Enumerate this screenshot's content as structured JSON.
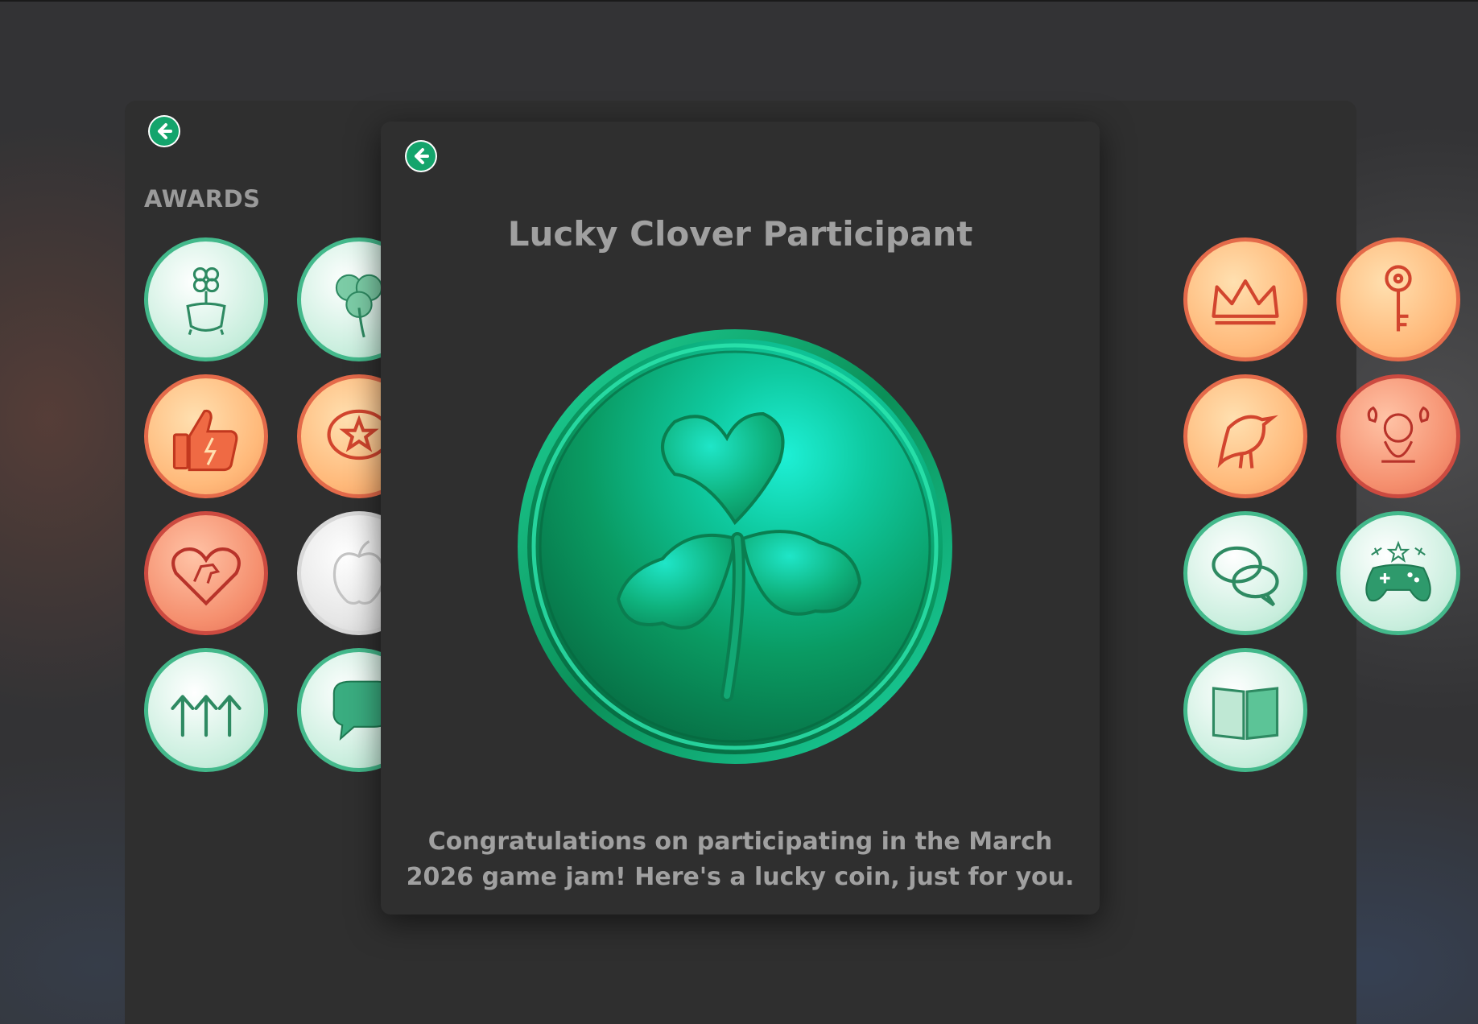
{
  "awards_panel": {
    "title": "AWARDS",
    "badges": [
      {
        "name": "pot-of-gold-clover-badge",
        "style": "green"
      },
      {
        "name": "shamrock-badge",
        "style": "green"
      },
      {
        "name": "crown-badge",
        "style": "orange"
      },
      {
        "name": "key-badge",
        "style": "orange"
      },
      {
        "name": "thumbs-up-lightning-badge",
        "style": "orange"
      },
      {
        "name": "star-speech-bubble-badge",
        "style": "orange"
      },
      {
        "name": "bird-badge",
        "style": "orange"
      },
      {
        "name": "dragon-creature-badge",
        "style": "red"
      },
      {
        "name": "horse-heart-badge",
        "style": "red"
      },
      {
        "name": "apple-badge",
        "style": "silver"
      },
      {
        "name": "chat-bubbles-badge",
        "style": "green"
      },
      {
        "name": "gamepad-badge",
        "style": "green"
      },
      {
        "name": "three-arrows-up-badge",
        "style": "green"
      },
      {
        "name": "speech-bubble-badge",
        "style": "green"
      },
      {
        "name": "open-book-badge",
        "style": "green"
      }
    ]
  },
  "modal": {
    "title": "Lucky Clover Participant",
    "description": "Congratulations on participating in the March 2026 game jam! Here's a lucky coin, just for you.",
    "coin_icon": "shamrock-coin"
  },
  "colors": {
    "accent_green": "#14a46c",
    "panel_bg": "#2f2f2f",
    "text_gray": "#a0a0a0"
  }
}
